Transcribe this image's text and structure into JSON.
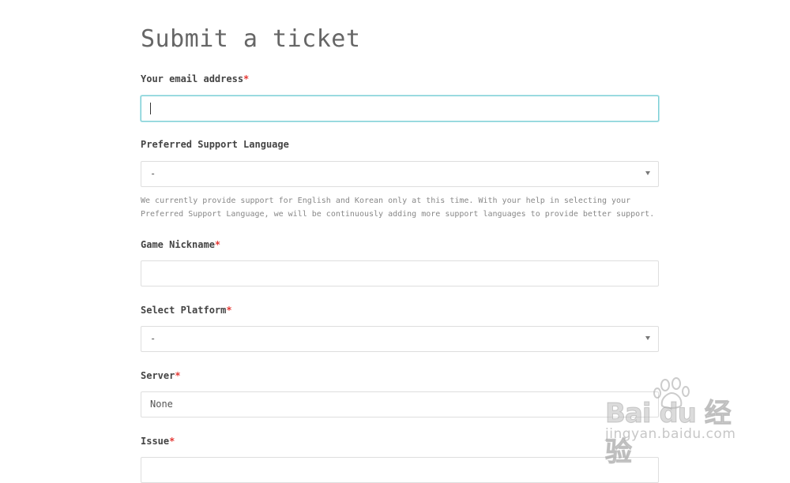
{
  "form": {
    "title": "Submit a ticket",
    "required_mark": "*",
    "email": {
      "label": "Your email address",
      "value": ""
    },
    "language": {
      "label": "Preferred Support Language",
      "selected": "-",
      "help_line_1": "We currently provide support for English and Korean only at this time. With your help in selecting your",
      "help_line_2": "Preferred Support Language, we will be continuously adding more support languages to provide better support."
    },
    "nickname": {
      "label": "Game Nickname",
      "value": ""
    },
    "platform": {
      "label": "Select Platform",
      "selected": "-"
    },
    "server": {
      "label": "Server",
      "selected": "None"
    },
    "issue": {
      "label": "Issue"
    }
  },
  "watermark": {
    "brand": "Bai du 经验",
    "url": "jingyan.baidu.com"
  },
  "colors": {
    "required": "#e53935",
    "focus_border": "#7ecfd6",
    "field_border": "#dedede"
  }
}
